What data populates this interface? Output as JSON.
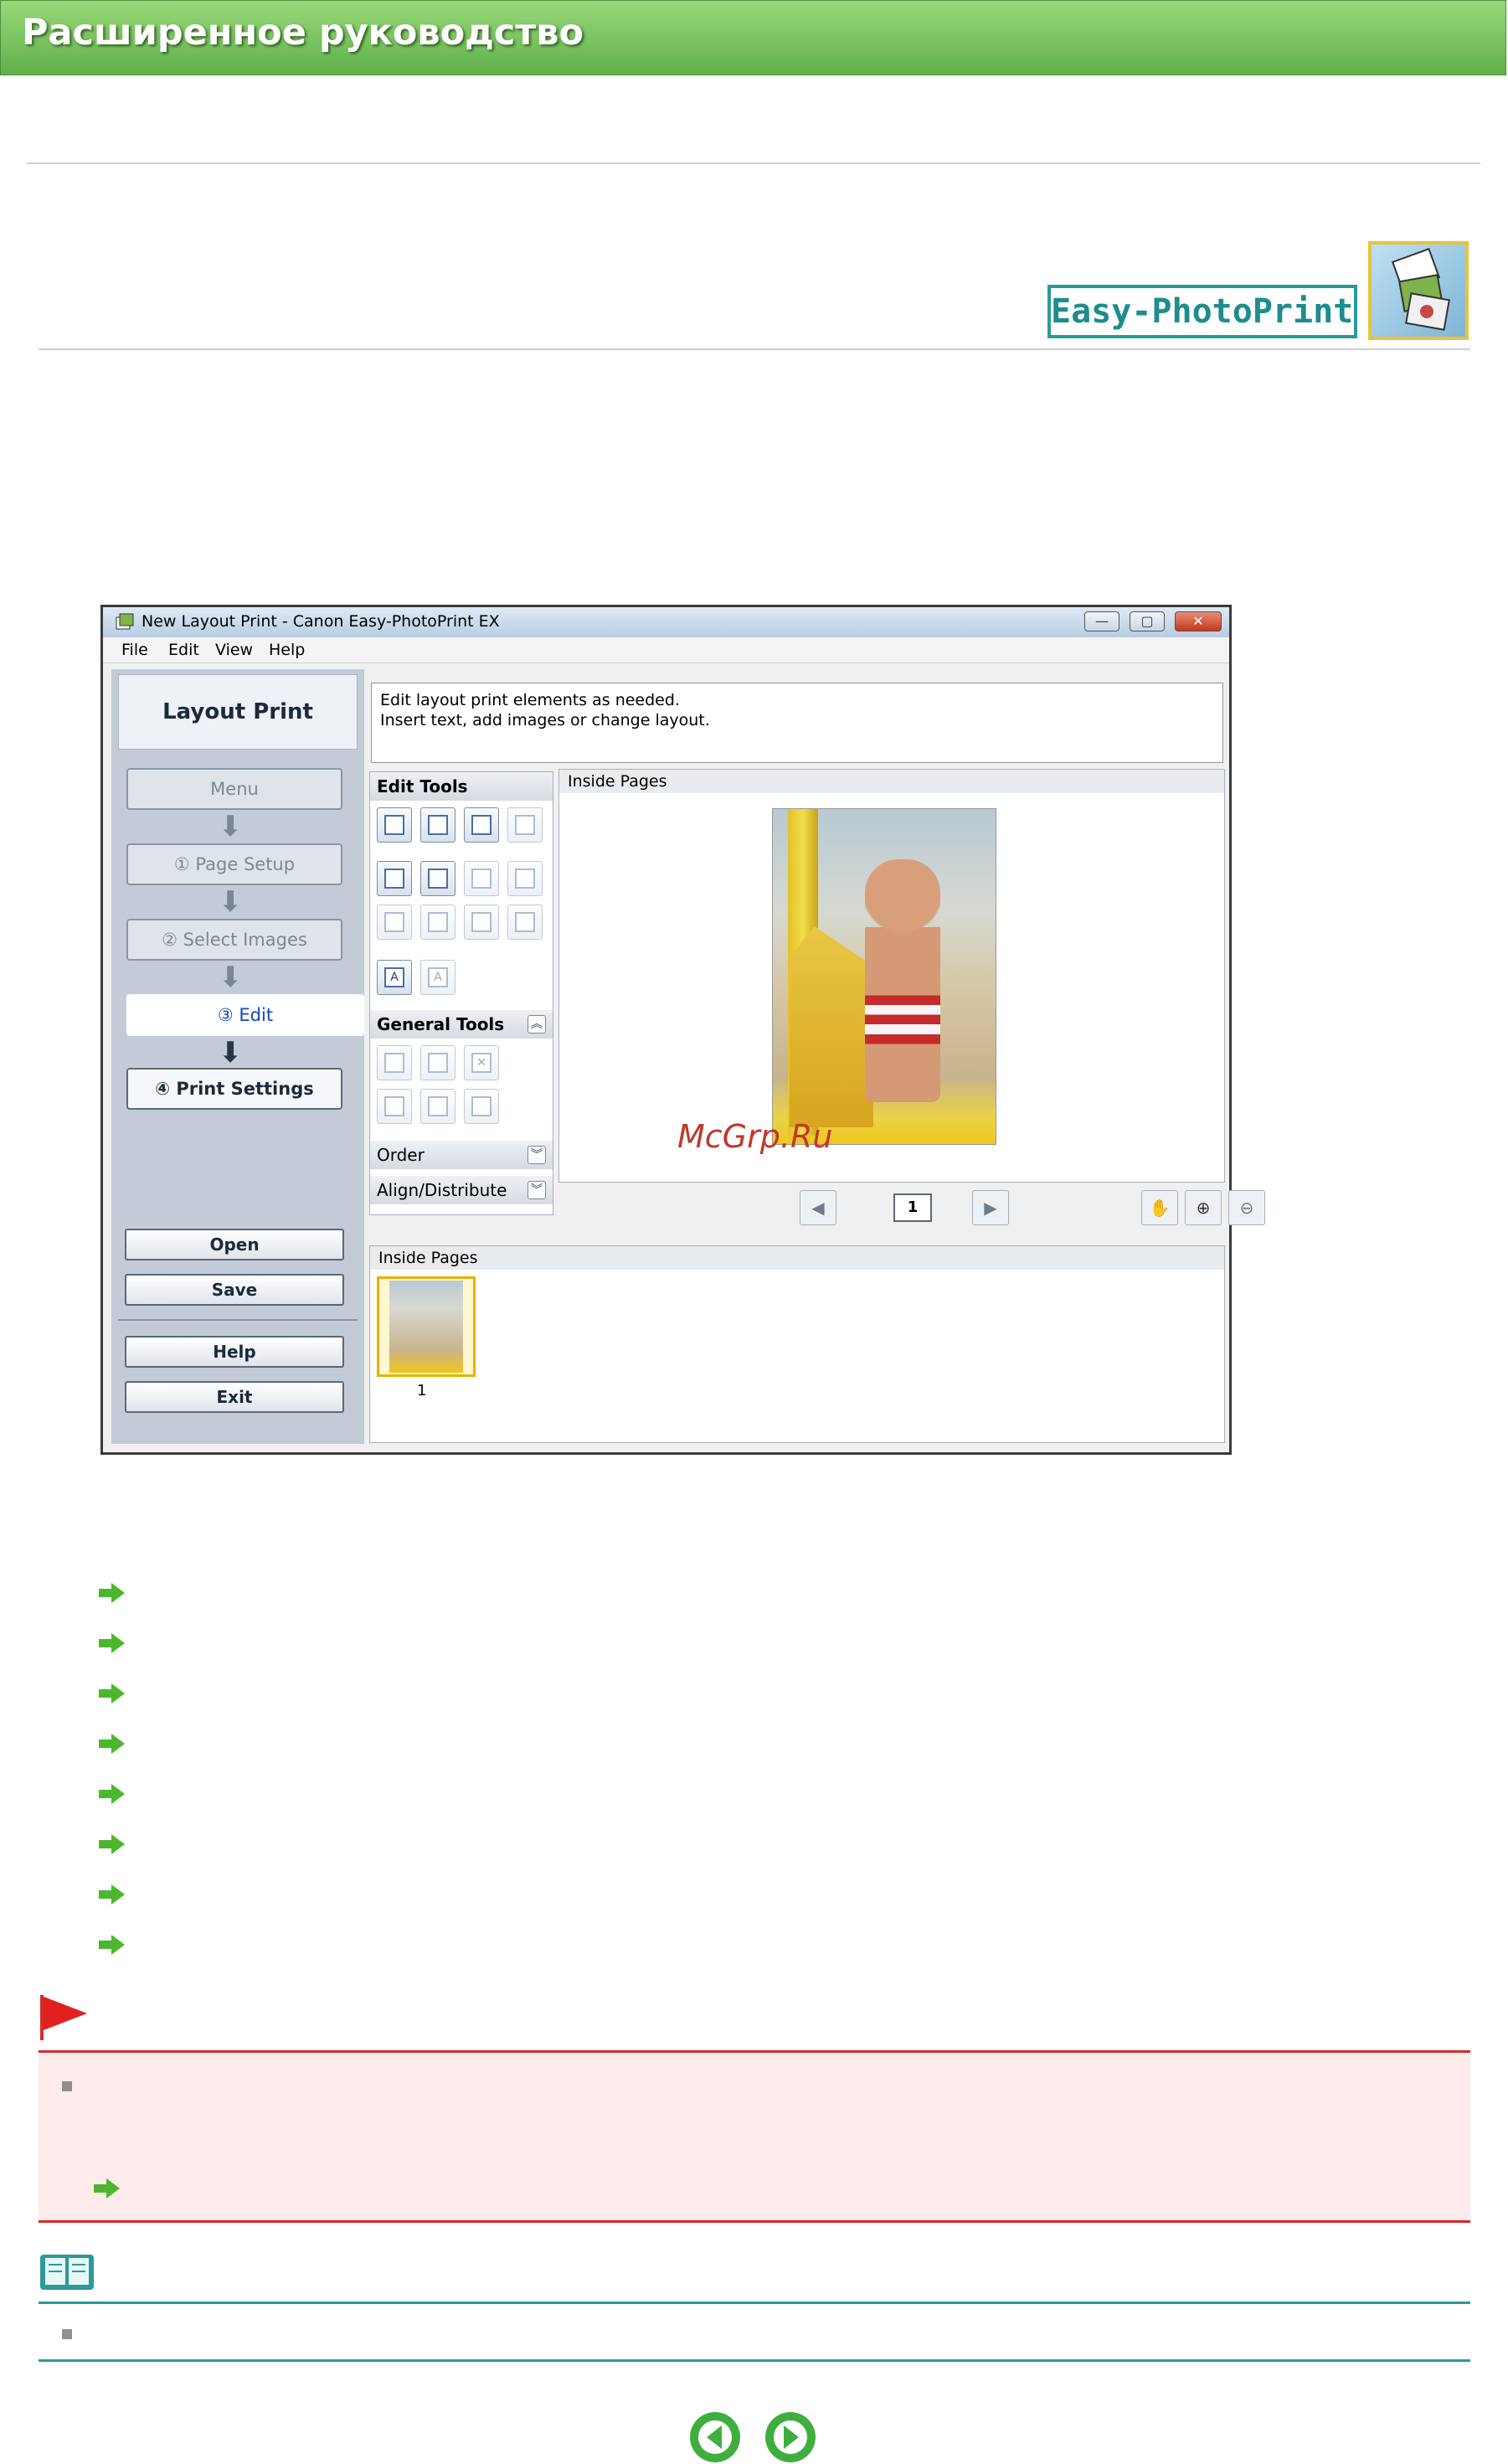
{
  "header": {
    "title": "Расширенное руководство"
  },
  "logo": {
    "text": "Easy-PhotoPrint EX"
  },
  "app": {
    "window_title": "New Layout Print - Canon Easy-PhotoPrint EX",
    "window_buttons": {
      "minimize": "—",
      "maximize": "▢",
      "close": "✕"
    },
    "menu": [
      "File",
      "Edit",
      "View",
      "Help"
    ],
    "left_panel": {
      "title": "Layout Print",
      "steps": [
        "Menu",
        "① Page Setup",
        "② Select Images",
        "③ Edit",
        "④ Print Settings"
      ],
      "buttons": [
        "Open",
        "Save",
        "Help",
        "Exit"
      ]
    },
    "description": {
      "line1": "Edit layout print elements as needed.",
      "line2": "Insert text, add images or change layout."
    },
    "tools": {
      "edit_tools": "Edit Tools",
      "general_tools": "General Tools",
      "order": "Order",
      "align": "Align/Distribute"
    },
    "preview": {
      "title": "Inside Pages",
      "page_number": "1"
    },
    "thumbnails": {
      "title": "Inside Pages",
      "page_label": "1"
    }
  },
  "watermark": "McGrp.Ru",
  "icons": {
    "link": "green-arrow-icon",
    "important": "red-flag-icon",
    "note": "book-icon",
    "prev": "back-arrow-icon",
    "next": "forward-arrow-icon"
  },
  "colors": {
    "header": "#5fb14a",
    "important_border": "#d62b2b",
    "note_border": "#2a9a9a",
    "accent": "#4cb72e"
  }
}
